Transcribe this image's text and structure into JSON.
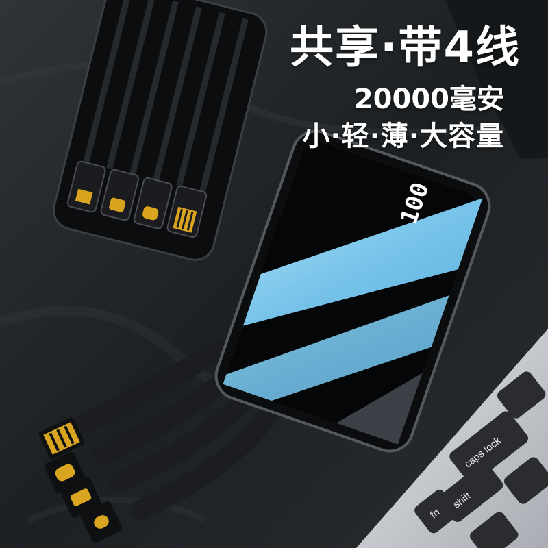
{
  "headline": {
    "title": "共享·带4线",
    "capacity": "20000毫安",
    "tagline": "小·轻·薄·大容量"
  },
  "device": {
    "display_value": "100"
  },
  "keyboard": {
    "keys": [
      "caps lock",
      "shift",
      "fn"
    ]
  },
  "colors": {
    "background": "#1f2326",
    "glass_blue": "#7ec8ec",
    "device_black": "#0c0d0f",
    "connector_gold": "#d9a520",
    "laptop_silver": "#c9ccd1"
  }
}
